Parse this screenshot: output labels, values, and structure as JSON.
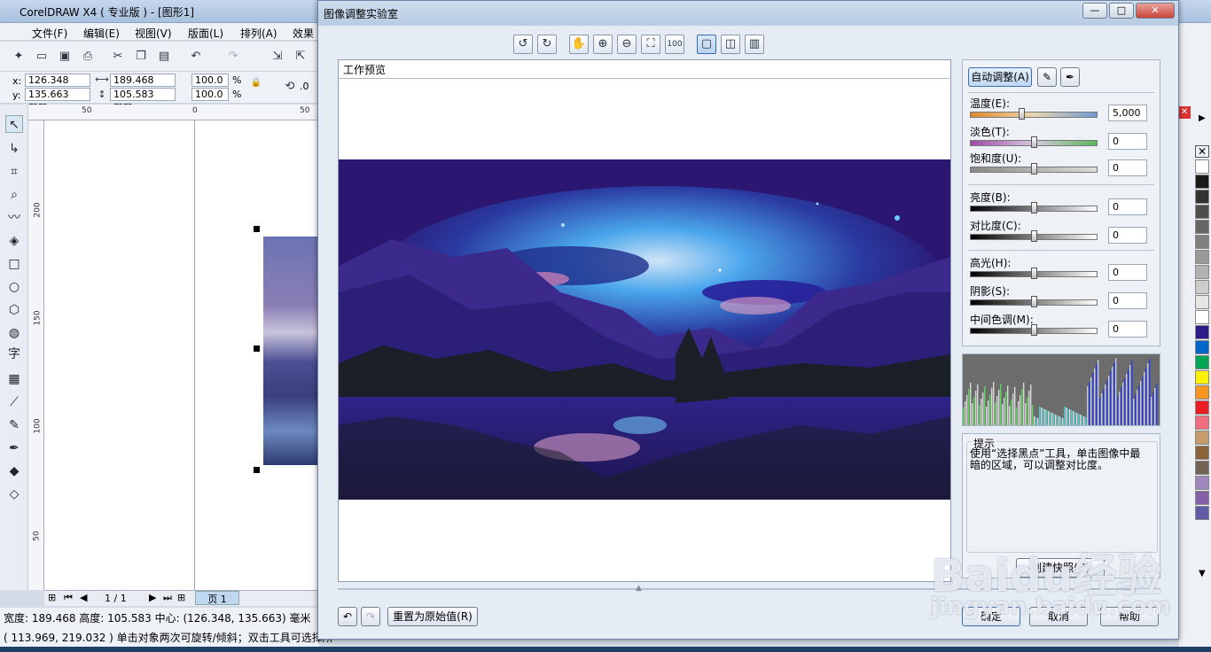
{
  "app": {
    "title": "CorelDRAW X4 ( 专业版 ) - [图形1]",
    "menu": [
      "文件(F)",
      "编辑(E)",
      "视图(V)",
      "版面(L)",
      "排列(A)",
      "效果"
    ],
    "prop": {
      "x_label": "x:",
      "x": "126.348 mm",
      "y_label": "y:",
      "y": "135.663 mm",
      "w": "189.468 mm",
      "h": "105.583 mm",
      "sx": "100.0",
      "sy": "100.0",
      "pct": "%",
      "rot": ".0"
    },
    "hruler": [
      "50",
      "0",
      "50"
    ],
    "vruler": [
      "200",
      "150",
      "100",
      "50"
    ],
    "page_tabs": {
      "counter": "1 / 1",
      "page": "页 1"
    },
    "status_line1": "宽度: 189.468 高度: 105.583 中心: (126.348, 135.663) 毫米",
    "status_line2": "( 113.969, 219.032 )     单击对象两次可旋转/倾斜；双击工具可选择所"
  },
  "dialog": {
    "title": "图像调整实验室",
    "win_buttons": {
      "min": "—",
      "max": "□",
      "close": "✕"
    },
    "toolbar_icons": [
      "rotate-left-icon",
      "rotate-right-icon",
      "hand-icon",
      "zoom-in-icon",
      "zoom-out-icon",
      "fit-icon",
      "zoom-100-icon",
      "single-view-icon",
      "split-view-icon",
      "split-vertical-icon"
    ],
    "preview_label": "工作预览",
    "auto_adjust": "自动调整(A)",
    "sliders": [
      {
        "label": "温度(E):",
        "value": "5,000",
        "position": 0.4
      },
      {
        "label": "淡色(T):",
        "value": "0",
        "position": 0.5
      },
      {
        "label": "饱和度(U):",
        "value": "0",
        "position": 0.5
      },
      {
        "label": "亮度(B):",
        "value": "0",
        "position": 0.5
      },
      {
        "label": "对比度(C):",
        "value": "0",
        "position": 0.5
      },
      {
        "label": "高光(H):",
        "value": "0",
        "position": 0.5
      },
      {
        "label": "阴影(S):",
        "value": "0",
        "position": 0.5
      },
      {
        "label": "中间色调(M):",
        "value": "0",
        "position": 0.5
      }
    ],
    "hint_title": "提示",
    "hint_text": "使用“选择黑点”工具，单击图像中最暗的区域，可以调整对比度。",
    "snapshot_button": "创建快照(C)",
    "reset_button": "重置为原始值(R)",
    "ok_button": "确定",
    "cancel_button": "取消",
    "help_button": "帮助"
  },
  "watermark": {
    "logo": "Baidu经验",
    "url": "jingyan.baidu.com"
  },
  "colors": {
    "photo_sky": "#2b1772",
    "photo_glow": "#3aa0e6",
    "palette": [
      "#ffffff",
      "#1a1a1a",
      "#333333",
      "#4d4d4d",
      "#666666",
      "#808080",
      "#999999",
      "#b3b3b3",
      "#cccccc",
      "#e6e6e6",
      "#ffffff",
      "#2e1a8a",
      "#0066cc",
      "#00a651",
      "#fff200",
      "#f7941d",
      "#ed1c24",
      "#f26d7d",
      "#c69c6d",
      "#8c6239",
      "#736357",
      "#a187be",
      "#8560a8",
      "#605ca8"
    ]
  }
}
